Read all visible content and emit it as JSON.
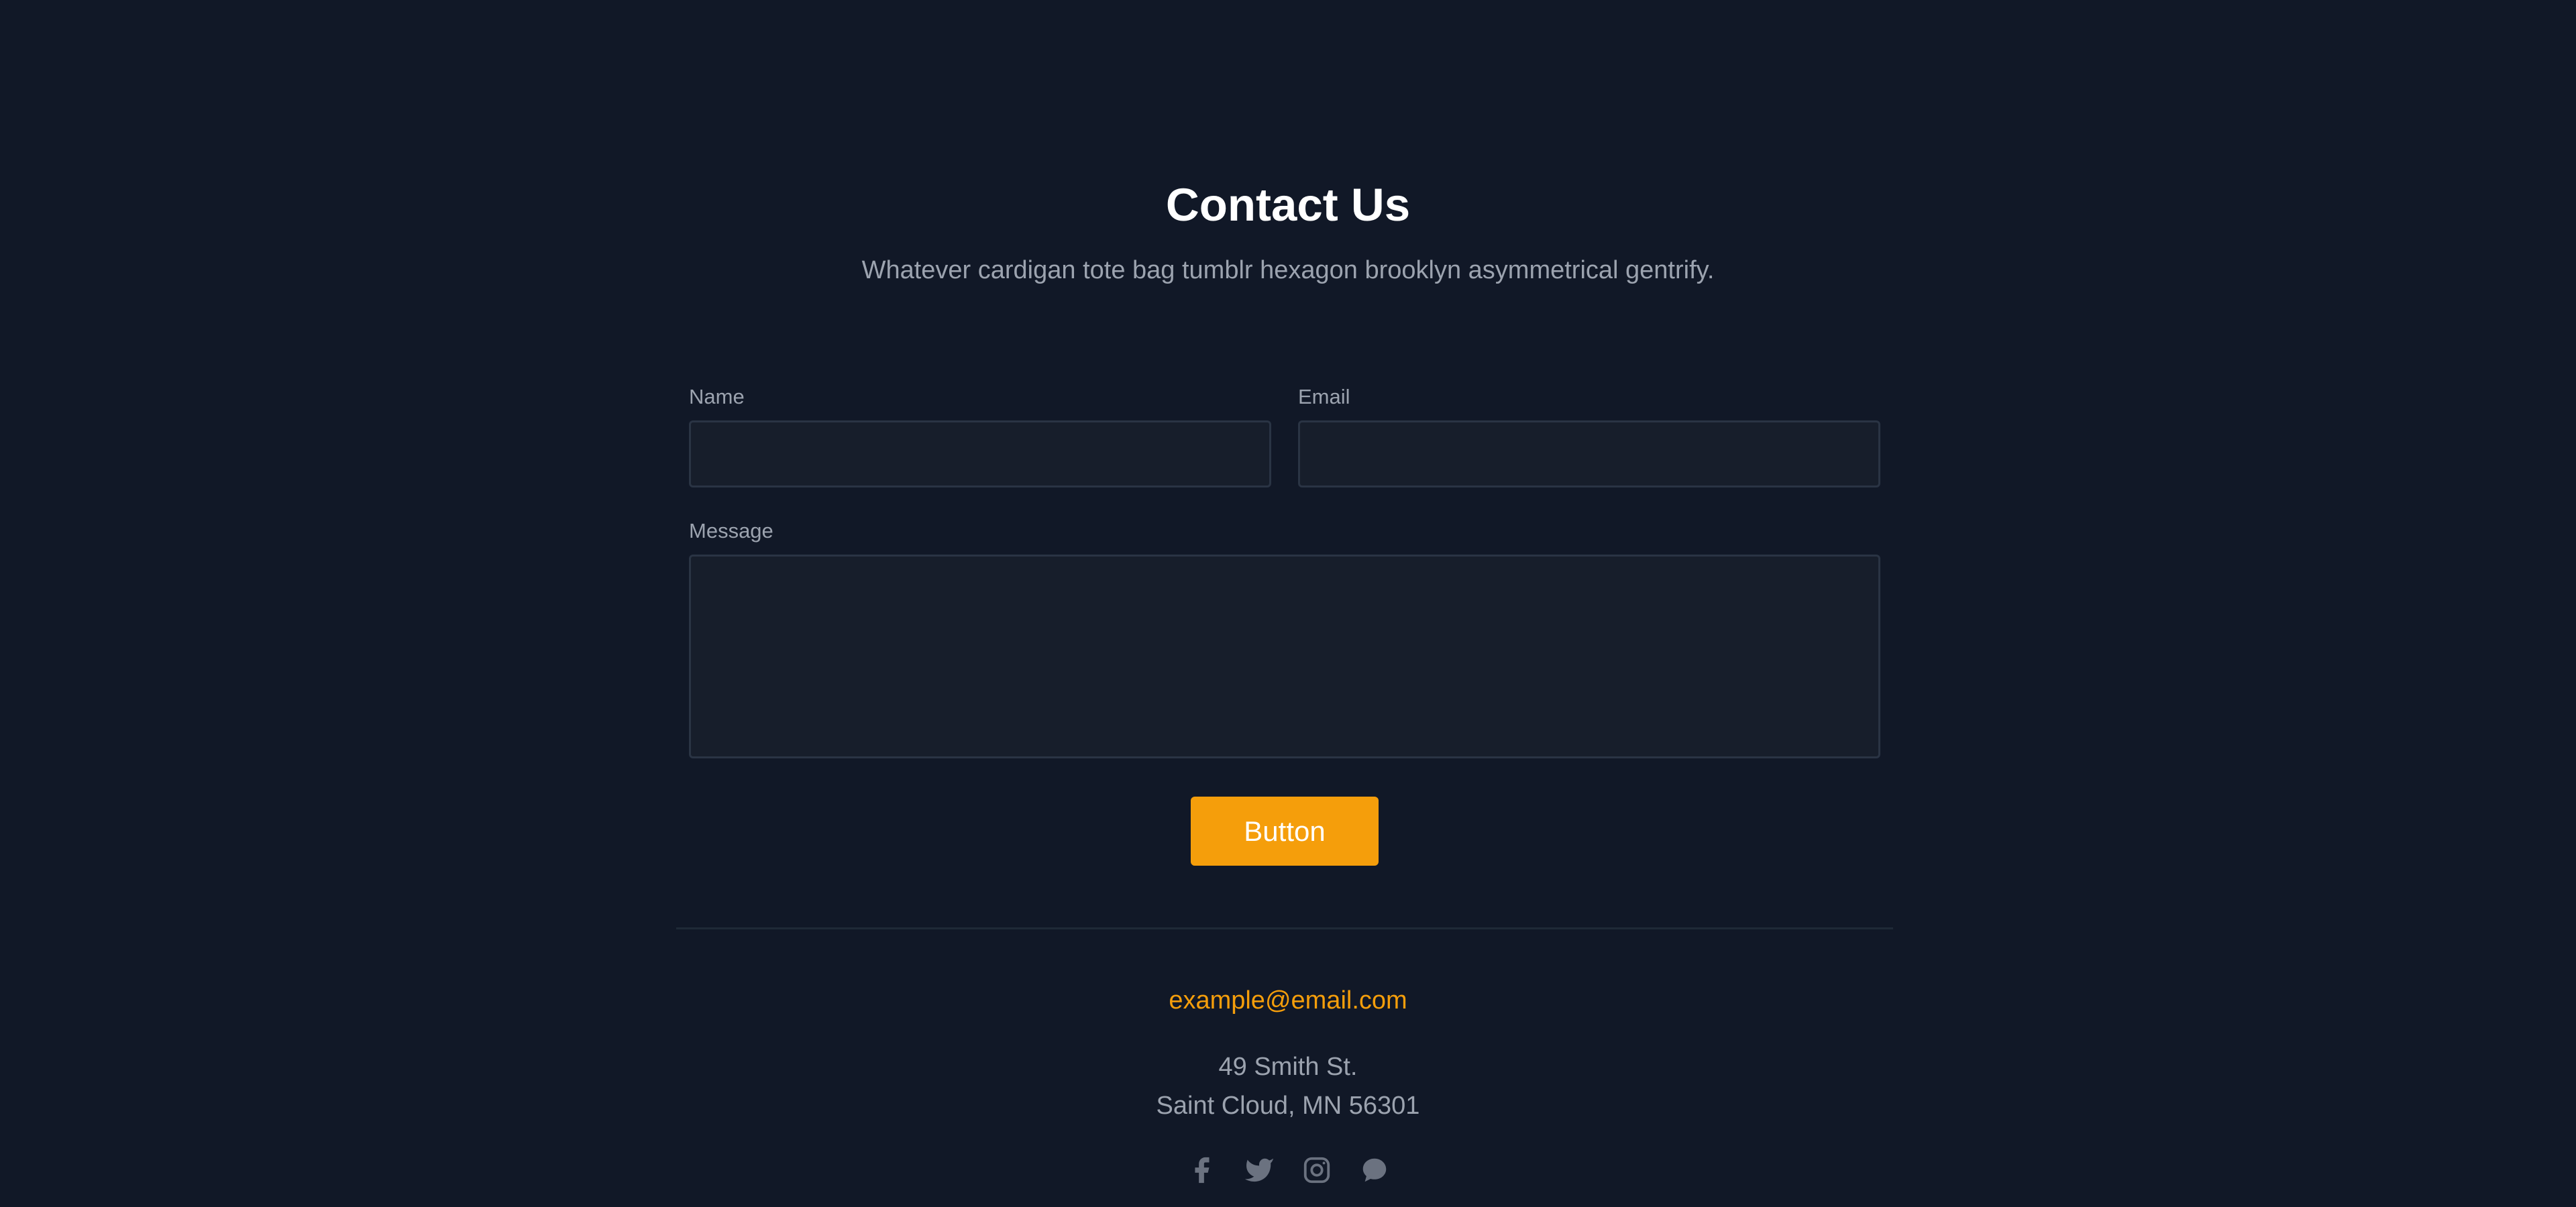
{
  "header": {
    "title": "Contact Us",
    "subtitle": "Whatever cardigan tote bag tumblr hexagon brooklyn asymmetrical gentrify."
  },
  "form": {
    "name_label": "Name",
    "name_value": "",
    "email_label": "Email",
    "email_value": "",
    "message_label": "Message",
    "message_value": "",
    "submit_label": "Button"
  },
  "footer": {
    "email": "example@email.com",
    "address_line1": "49 Smith St.",
    "address_line2": "Saint Cloud, MN 56301",
    "social_icons": [
      "facebook-icon",
      "twitter-icon",
      "instagram-icon",
      "chat-icon"
    ]
  },
  "colors": {
    "background": "#111827",
    "accent": "#f59e0b",
    "heading": "#ffffff",
    "text_muted": "#9ca3af",
    "input_background": "#171e2b",
    "input_border": "#2a3444"
  }
}
